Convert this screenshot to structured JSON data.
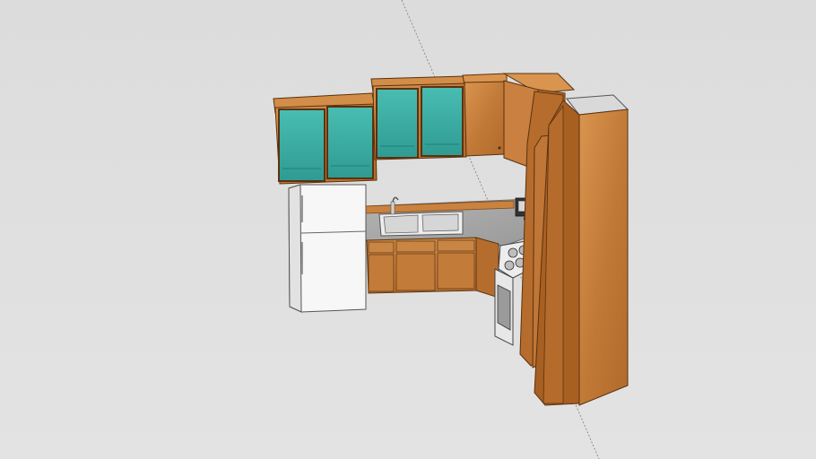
{
  "viewport": {
    "background": "#dedede",
    "axis_color": "#7a7a7a"
  },
  "model": {
    "subject": "",
    "colors": {
      "wood": "#c57a38",
      "wood_light": "#d99450",
      "wood_dark": "#7a4614",
      "glass": "#3fb3a8",
      "glass_dark": "#1f7f78",
      "counter": "#a7a7a7",
      "appliance": "#f4f4f4",
      "steel": "#cfcfcf"
    },
    "components": [
      "refrigerator",
      "upper-cabinet-glass-left",
      "upper-cabinet-glass-middle",
      "upper-cabinet-solid",
      "corner-upper-cabinet",
      "countertop",
      "double-sink",
      "faucet",
      "base-cabinets",
      "stove",
      "coffee-maker",
      "tall-pantry-cabinet"
    ]
  }
}
